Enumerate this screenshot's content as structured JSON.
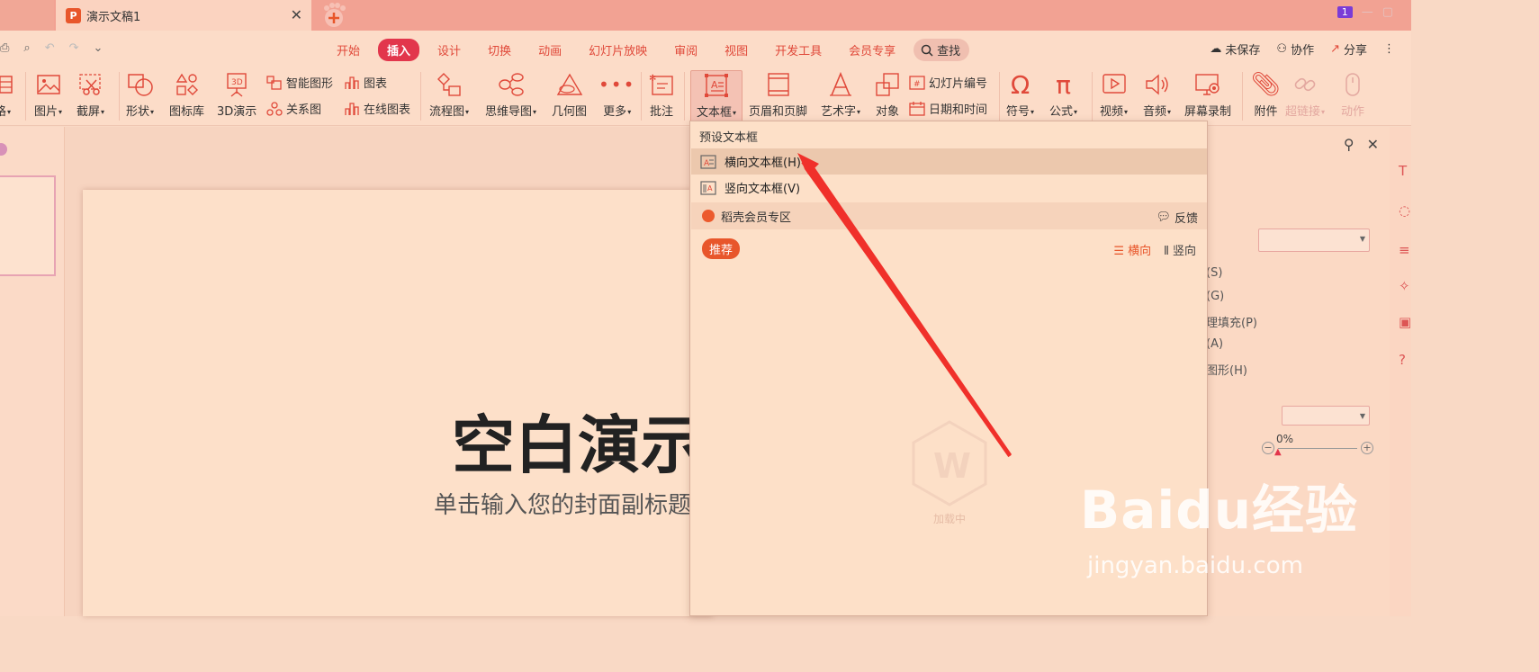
{
  "titlebar": {
    "doc_title": "演示文稿1",
    "badge": "1"
  },
  "quick_access": [
    "⎙",
    "⌕",
    "↶",
    "↷",
    "⌄"
  ],
  "menu": {
    "items": [
      "开始",
      "插入",
      "设计",
      "切换",
      "动画",
      "幻灯片放映",
      "审阅",
      "视图",
      "开发工具",
      "会员专享"
    ],
    "active_index": 1,
    "search": "查找",
    "unsaved": "未保存",
    "collab": "协作",
    "share": "分享"
  },
  "ribbon": {
    "left_cut": "格",
    "picture": "图片",
    "screenshot": "截屏",
    "shape": "形状",
    "icon_lib": "图标库",
    "demo3d": "3D演示",
    "smart_shape": "智能图形",
    "chart": "图表",
    "relation": "关系图",
    "online_chart": "在线图表",
    "flowchart": "流程图",
    "mindmap": "思维导图",
    "geometry": "几何图",
    "more": "更多",
    "comment": "批注",
    "textbox": "文本框",
    "header_footer": "页眉和页脚",
    "wordart": "艺术字",
    "object": "对象",
    "slide_number": "幻灯片编号",
    "datetime": "日期和时间",
    "symbol": "符号",
    "formula": "公式",
    "video": "视频",
    "audio": "音频",
    "screen_record": "屏幕录制",
    "attachment": "附件",
    "hyperlink": "超链接",
    "action": "动作"
  },
  "dropdown": {
    "header": "预设文本框",
    "items": [
      "横向文本框(H)",
      "竖向文本框(V)"
    ],
    "vip": "稻壳会员专区",
    "feedback": "反馈",
    "recommend": "推荐",
    "horizontal": "横向",
    "vertical": "竖向",
    "loading": "加载中"
  },
  "slide": {
    "title": "空白演示",
    "subtitle": "单击输入您的封面副标题"
  },
  "right_pane": {
    "lines": [
      "(S)",
      "(G)",
      "理填充(P)",
      "(A)",
      "图形(H)"
    ],
    "percent": "0%"
  },
  "watermark": {
    "brand": "Baidu经验",
    "url": "jingyan.baidu.com"
  },
  "colors": {
    "accent": "#e2364c",
    "menu_text": "#e0493a",
    "arrow": "#f0302a"
  }
}
